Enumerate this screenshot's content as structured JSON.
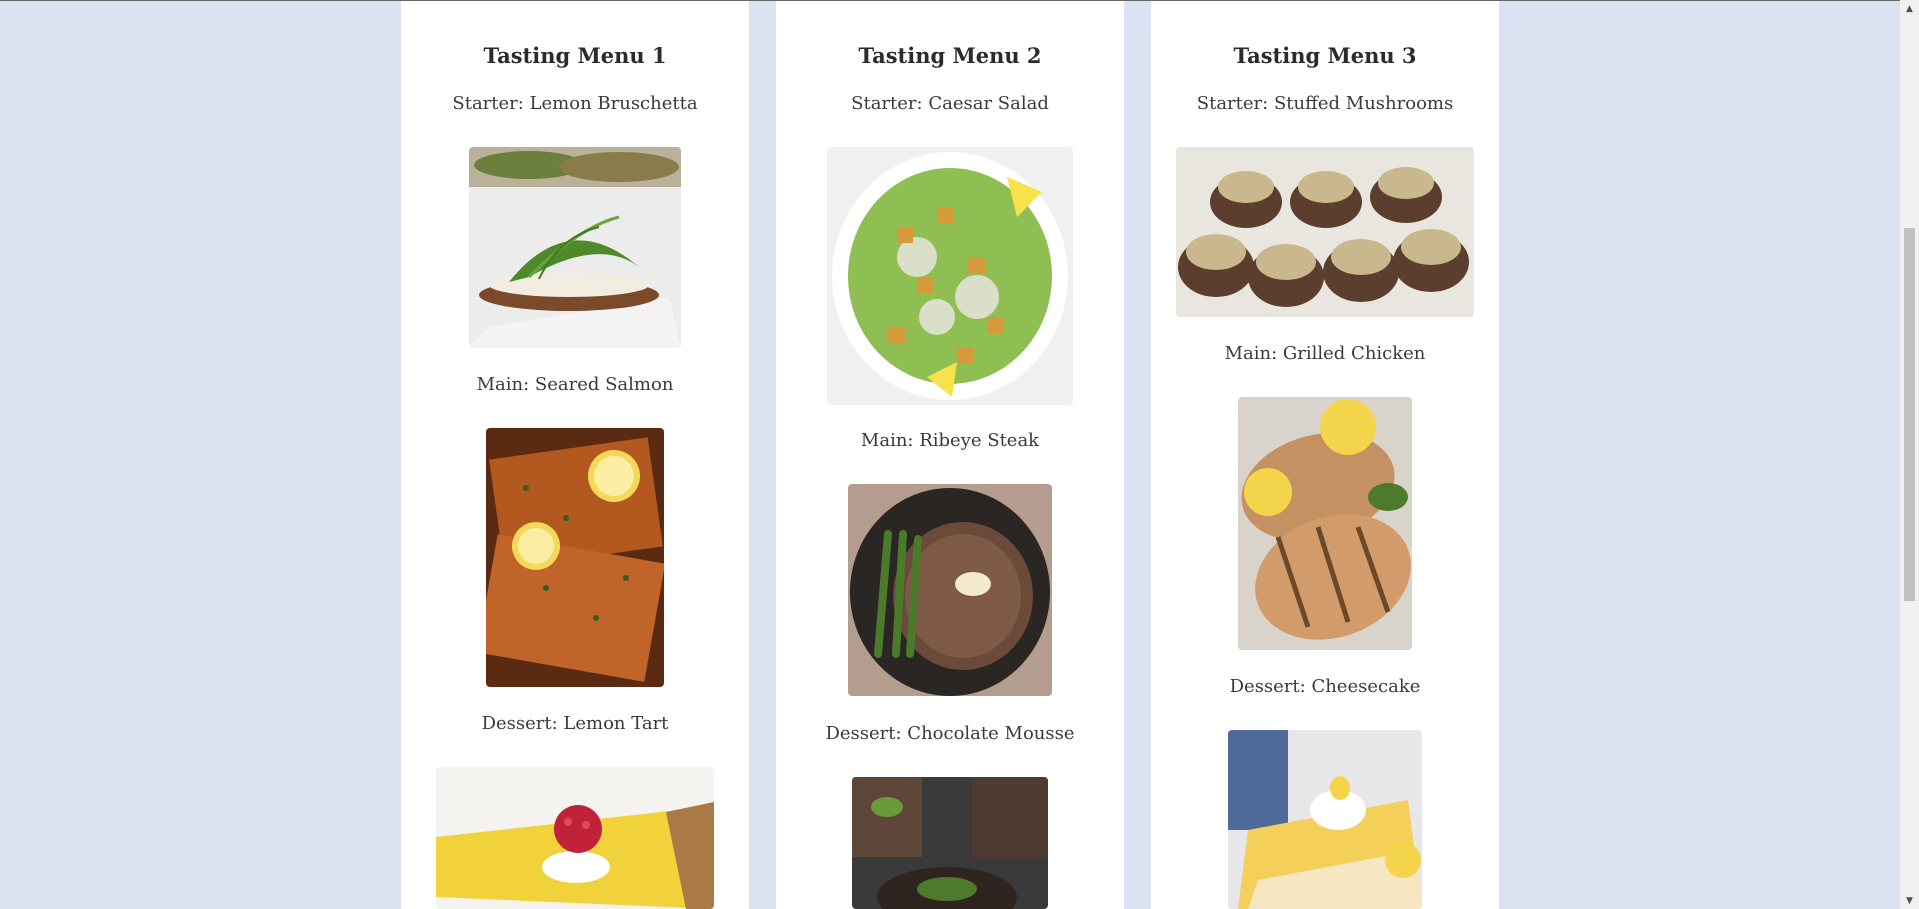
{
  "menus": [
    {
      "title": "Tasting Menu 1",
      "courses": [
        {
          "label": "Starter: Lemon Bruschetta",
          "image": "lemon-bruschetta"
        },
        {
          "label": "Main: Seared Salmon",
          "image": "seared-salmon"
        },
        {
          "label": "Dessert: Lemon Tart",
          "image": "lemon-tart"
        }
      ]
    },
    {
      "title": "Tasting Menu 2",
      "courses": [
        {
          "label": "Starter: Caesar Salad",
          "image": "caesar-salad"
        },
        {
          "label": "Main: Ribeye Steak",
          "image": "ribeye-steak"
        },
        {
          "label": "Dessert: Chocolate Mousse",
          "image": "chocolate-mousse"
        }
      ]
    },
    {
      "title": "Tasting Menu 3",
      "courses": [
        {
          "label": "Starter: Stuffed Mushrooms",
          "image": "stuffed-mushrooms"
        },
        {
          "label": "Main: Grilled Chicken",
          "image": "grilled-chicken"
        },
        {
          "label": "Dessert: Cheesecake",
          "image": "cheesecake"
        }
      ]
    }
  ],
  "colors": {
    "page_background": "#dbe2f1",
    "card_background": "#ffffff",
    "text": "#333333"
  }
}
